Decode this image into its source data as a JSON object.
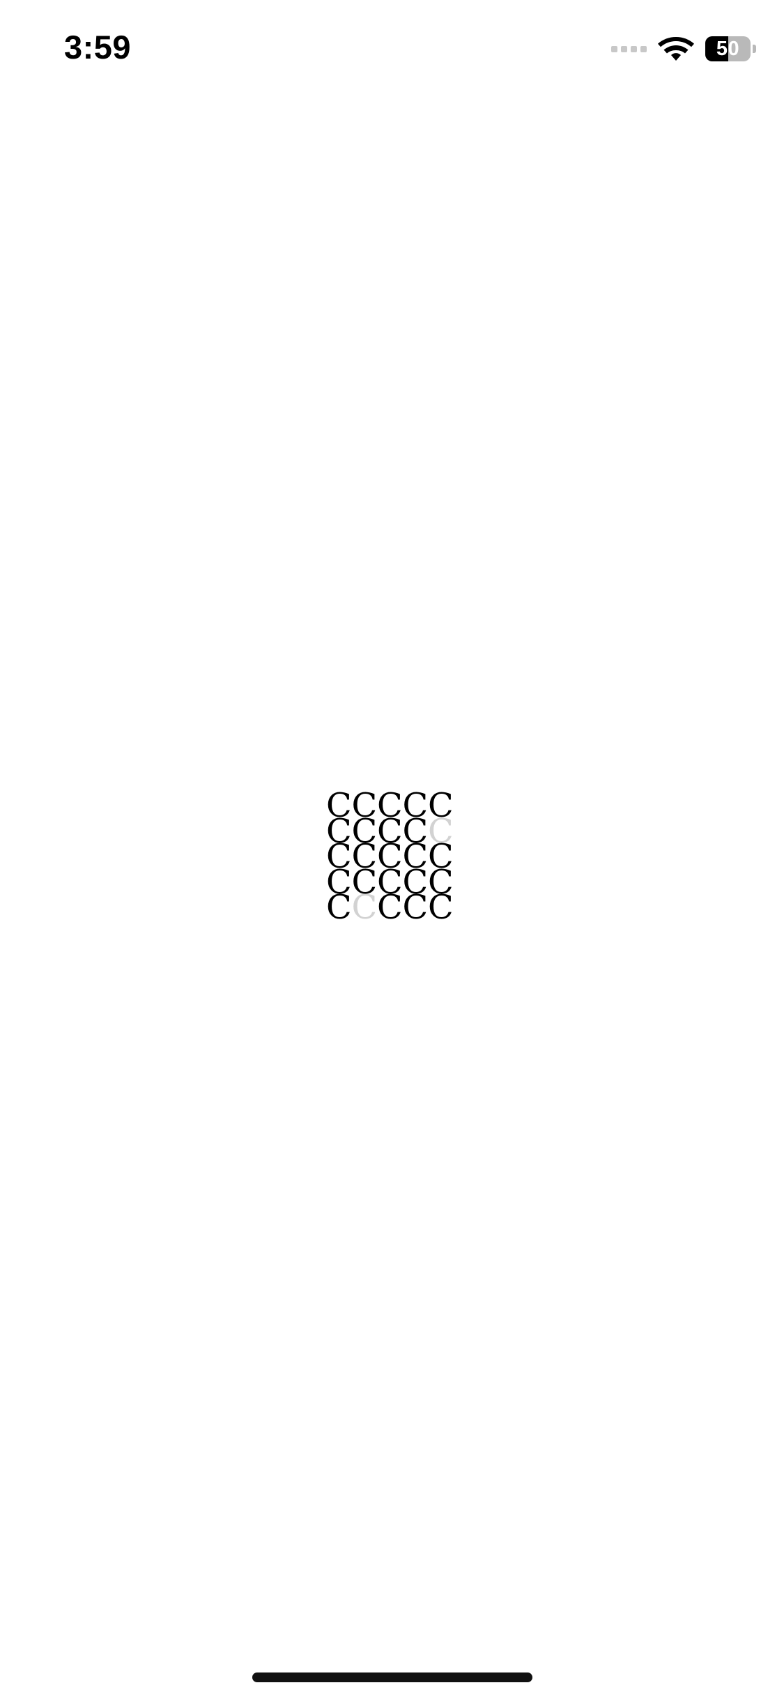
{
  "status_bar": {
    "time": "3:59",
    "battery_level": "50",
    "battery_fraction": 0.5,
    "signal_icon": "cellular-signal-icon",
    "wifi_icon": "wifi-icon",
    "battery_icon": "battery-icon"
  },
  "logo": {
    "rows": [
      [
        "C",
        "C",
        "C",
        "C",
        "C"
      ],
      [
        "C",
        "C",
        "C",
        "C",
        "C"
      ],
      [
        "C",
        "C",
        "C",
        "C",
        "C"
      ],
      [
        "C",
        "C",
        "C",
        "C",
        "C"
      ],
      [
        "C",
        "C",
        "C",
        "C",
        "C"
      ]
    ],
    "faded": [
      [
        1,
        4
      ],
      [
        4,
        1
      ]
    ],
    "letter_color": "#000000",
    "faded_color": "#d2d2d2"
  },
  "colors": {
    "background": "#ffffff",
    "home_indicator": "#111111"
  }
}
